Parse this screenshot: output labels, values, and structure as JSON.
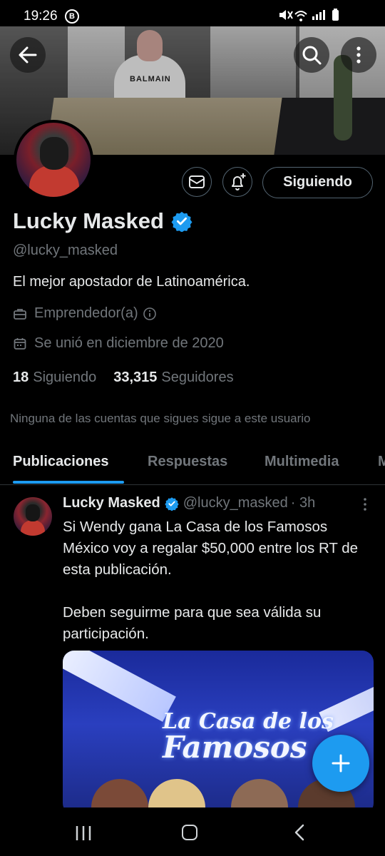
{
  "status_bar": {
    "time": "19:26",
    "badge": "B",
    "icons": "🔇 📶 ▮"
  },
  "profile": {
    "display_name": "Lucky Masked",
    "handle": "@lucky_masked",
    "bio": "El mejor apostador de Latinoamérica.",
    "category": "Emprendedor(a)",
    "joined": "Se unió en diciembre de 2020",
    "following_count": "18",
    "following_label": "Siguiendo",
    "followers_count": "33,315",
    "followers_label": "Seguidores",
    "follow_button": "Siguiendo",
    "mutuals_notice": "Ninguna de las cuentas que sigues sigue a este usuario"
  },
  "tabs": [
    {
      "label": "Publicaciones",
      "active": true
    },
    {
      "label": "Respuestas",
      "active": false
    },
    {
      "label": "Multimedia",
      "active": false
    },
    {
      "label": "M",
      "active": false
    }
  ],
  "tweet": {
    "name": "Lucky Masked",
    "handle": "@lucky_masked",
    "time": "· 3h",
    "paragraph1": "Si Wendy gana La Casa de los Famosos México voy a regalar $50,000 entre los RT de esta publicación.",
    "paragraph2": "Deben seguirme para que sea válida su participación.",
    "media_title_line1": "La Casa de los",
    "media_title_line2": "Famosos"
  },
  "banner_tshirt_text": "BALMAIN",
  "colors": {
    "accent": "#1d9bf0",
    "secondary_text": "#71767b",
    "primary_text": "#e7e9ea",
    "background": "#000000"
  }
}
